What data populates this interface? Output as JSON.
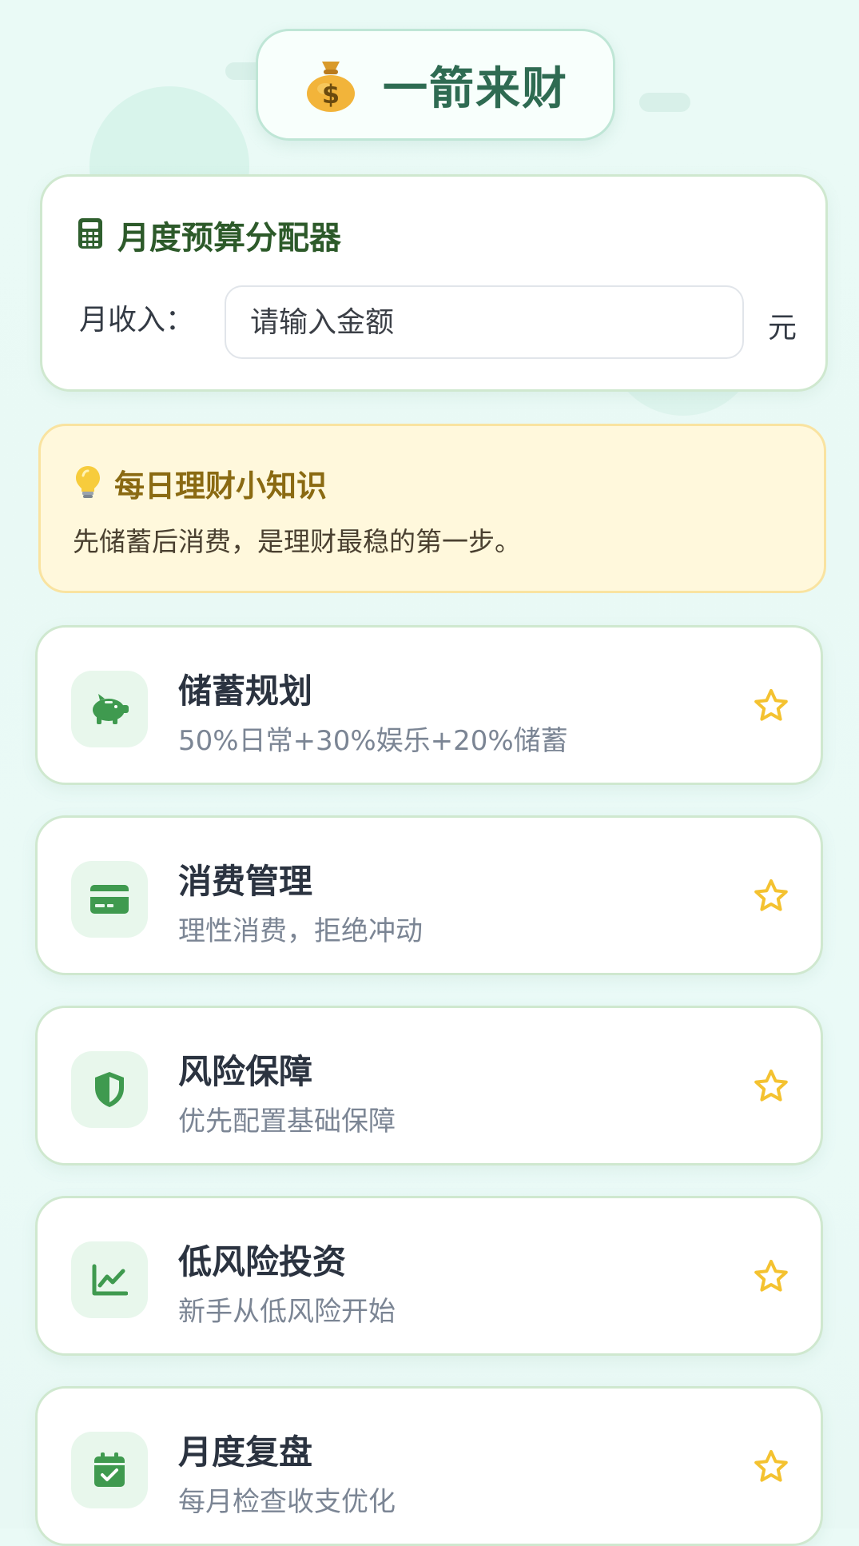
{
  "header": {
    "title": "一箭来财",
    "icon": "money-bag-icon"
  },
  "budget": {
    "title": "月度预算分配器",
    "icon": "calculator-icon",
    "income_label": "月收入：",
    "input_placeholder": "请输入金额",
    "input_value": "",
    "unit": "元"
  },
  "tip": {
    "icon": "lightbulb-icon",
    "title": "每日理财小知识",
    "body": "先储蓄后消费，是理财最稳的第一步。"
  },
  "items": [
    {
      "title": "储蓄规划",
      "subtitle": "50%日常+30%娱乐+20%储蓄",
      "icon": "piggy-bank-icon",
      "favorited": false
    },
    {
      "title": "消费管理",
      "subtitle": "理性消费，拒绝冲动",
      "icon": "credit-card-icon",
      "favorited": false
    },
    {
      "title": "风险保障",
      "subtitle": "优先配置基础保障",
      "icon": "shield-icon",
      "favorited": false
    },
    {
      "title": "低风险投资",
      "subtitle": "新手从低风险开始",
      "icon": "line-chart-icon",
      "favorited": false
    },
    {
      "title": "月度复盘",
      "subtitle": "每月检查收支优化",
      "icon": "calendar-check-icon",
      "favorited": false
    }
  ],
  "colors": {
    "accent_green": "#3f9a4f",
    "title_green": "#2f6b52",
    "star_yellow": "#f4c230",
    "tip_background": "#fff8dc"
  }
}
